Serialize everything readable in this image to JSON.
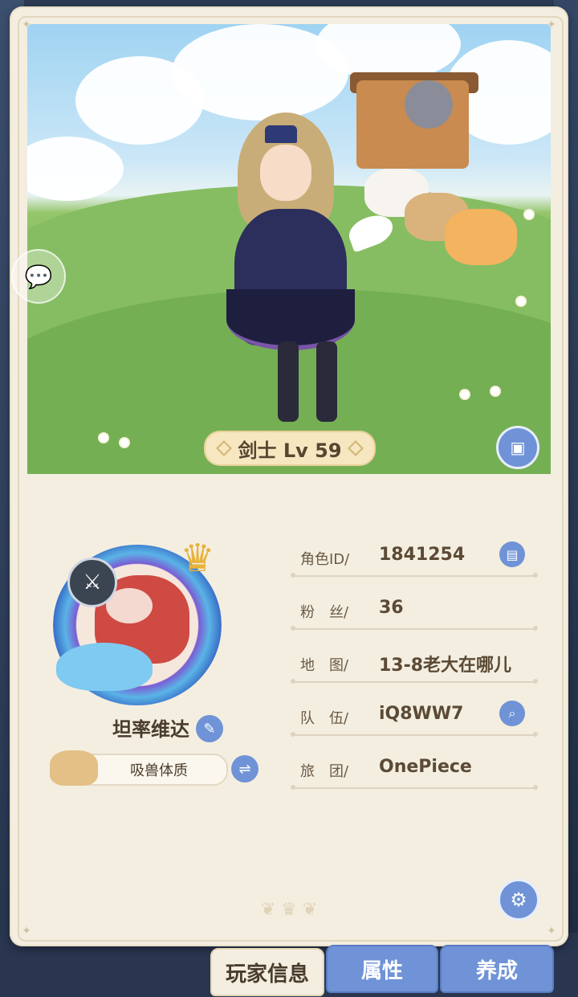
{
  "scene": {
    "level_label": "剑士 Lv 59"
  },
  "player": {
    "name": "坦率维达",
    "trait": "吸兽体质"
  },
  "info": {
    "rows": [
      {
        "label": "角色ID/",
        "value": "1841254",
        "action_icon": "copy-icon"
      },
      {
        "label": "粉　丝/",
        "value": "36"
      },
      {
        "label": "地　图/",
        "value": "13-8老大在哪儿"
      },
      {
        "label": "队　伍/",
        "value": "iQ8WW7",
        "action_icon": "search-icon"
      },
      {
        "label": "旅　团/",
        "value": "OnePiece"
      }
    ]
  },
  "tabs": [
    {
      "label": "玩家信息",
      "active": true
    },
    {
      "label": "属性",
      "active": false
    },
    {
      "label": "养成",
      "active": false
    }
  ],
  "colors": {
    "accent_blue": "#6f93d6",
    "card_bg": "#f4eee1",
    "text_brown": "#4a3c2c"
  }
}
